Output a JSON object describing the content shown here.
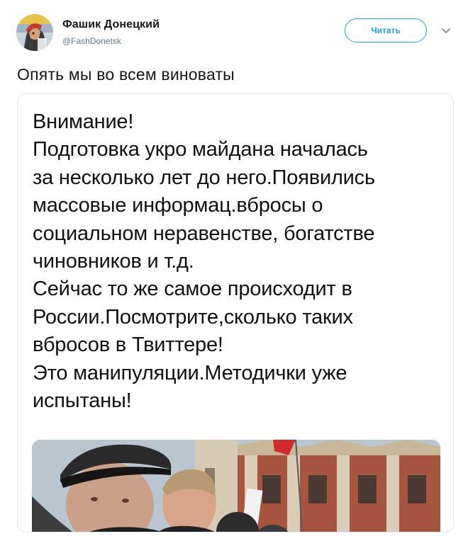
{
  "author": {
    "display_name": "Фашик Донецкий",
    "handle": "@FashDonetsk"
  },
  "actions": {
    "follow_label": "Читать",
    "menu_icon": "chevron-down-icon"
  },
  "tweet": {
    "text": "Опять мы во всем виноваты"
  },
  "card": {
    "lines": [
      "Внимание!",
      "Подготовка укро майдана началась",
      "за несколько лет до него.Появились",
      "массовые информац.вбросы о",
      "социальном неравенстве, богатстве",
      "чиновников и т.д.",
      "Сейчас то же самое происходит в",
      "России.Посмотрите,сколько таких",
      "вбросов в Твиттере!",
      "Это манипуляции.Методички уже",
      "испытаны!"
    ]
  },
  "colors": {
    "accent": "#1da1f2",
    "handle": "#657786",
    "border": "#e1e8ed"
  }
}
